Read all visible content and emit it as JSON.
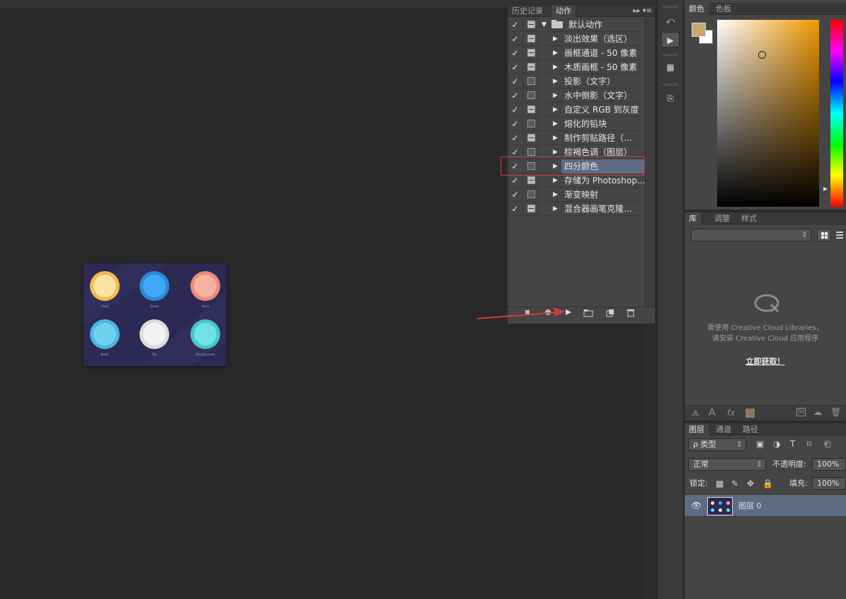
{
  "colors": {
    "accent_selection": "#5d6b83",
    "annotation_red": "#d23a3a",
    "foreground_swatch": "#c8a670",
    "background_swatch": "#ffffff",
    "canvas_bg": "#2c2a54"
  },
  "actions_panel": {
    "tabs": [
      {
        "label": "历史记录"
      },
      {
        "label": "动作"
      }
    ],
    "menu_glyph": "▸▸ ▾≡",
    "set_name": "默认动作",
    "actions": [
      {
        "label": "淡出效果（选区）",
        "checked": true,
        "dialog": true
      },
      {
        "label": "画框通道 - 50 像素",
        "checked": true,
        "dialog": true
      },
      {
        "label": "木质画框 - 50 像素",
        "checked": true,
        "dialog": true
      },
      {
        "label": "投影（文字）",
        "checked": true,
        "dialog": false
      },
      {
        "label": "水中倒影（文字）",
        "checked": true,
        "dialog": false
      },
      {
        "label": "自定义 RGB 到灰度",
        "checked": true,
        "dialog": true
      },
      {
        "label": "熔化的铅块",
        "checked": true,
        "dialog": false
      },
      {
        "label": "制作剪贴路径（...",
        "checked": true,
        "dialog": true
      },
      {
        "label": "棕褐色调（图层）",
        "checked": true,
        "dialog": false
      },
      {
        "label": "四分颜色",
        "checked": true,
        "dialog": false,
        "selected": true
      },
      {
        "label": "存储为 Photoshop...",
        "checked": true,
        "dialog": true
      },
      {
        "label": "渐变映射",
        "checked": true,
        "dialog": false
      },
      {
        "label": "混合器画笔克隆...",
        "checked": true,
        "dialog": true
      }
    ],
    "check_glyph": "✓",
    "bottom_icons": [
      "stop-icon",
      "record-icon",
      "play-icon",
      "folder-icon",
      "new-action-icon",
      "trash-icon"
    ]
  },
  "canvas": {
    "apps": [
      {
        "name": "Clock",
        "color": "#fbe3a8",
        "ring": "#f7b84a"
      },
      {
        "name": "Game",
        "color": "#3fa9f5",
        "ring": "#2b8ad6"
      },
      {
        "name": "Voice",
        "color": "#f6b3a1",
        "ring": "#ee8a79"
      },
      {
        "name": "Email",
        "color": "#6fd3ef",
        "ring": "#4cb7e0"
      },
      {
        "name": "File",
        "color": "#f2f2f2",
        "ring": "#dcdcdc"
      },
      {
        "name": "Driving mode",
        "color": "#6fe3e3",
        "ring": "#45c7c7"
      }
    ]
  },
  "color_panel": {
    "tabs": [
      {
        "label": "颜色"
      },
      {
        "label": "色板"
      }
    ]
  },
  "library_panel": {
    "tabs": [
      {
        "label": "库"
      },
      {
        "label": "调整"
      },
      {
        "label": "样式"
      }
    ],
    "message_line1": "要使用 Creative Cloud Libraries，",
    "message_line2": "请安装 Creative Cloud 应用程序",
    "link": "立即获取！"
  },
  "layers_panel": {
    "tabs": [
      {
        "label": "图层"
      },
      {
        "label": "通道"
      },
      {
        "label": "路径"
      }
    ],
    "filter_label": "ρ 类型",
    "blend_mode": "正常",
    "opacity_label": "不透明度:",
    "opacity_value": "100%",
    "lock_label": "锁定:",
    "fill_label": "填充:",
    "fill_value": "100%",
    "layer_name": "图层 0"
  }
}
